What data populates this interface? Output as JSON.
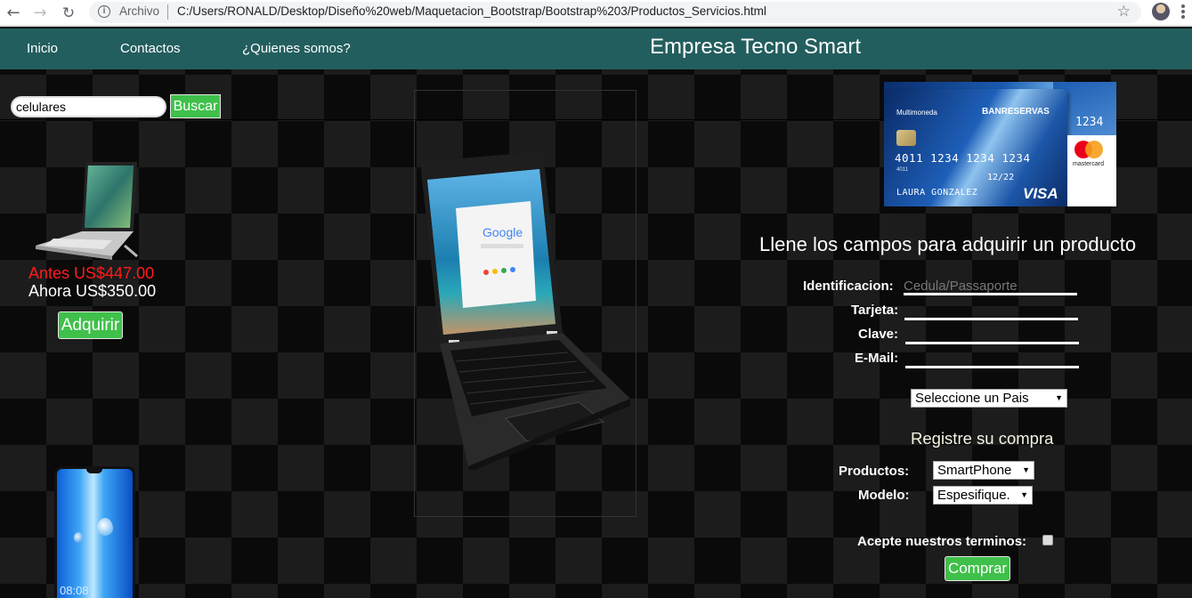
{
  "browser": {
    "scheme_label": "Archivo",
    "url": "C:/Users/RONALD/Desktop/Dise%C3%B1o%20web/Maquetacion_Bootstrap/Bootstrap%203/Productos_Servicios.html",
    "url_display": "C:/Users/RONALD/Desktop/Diseño%20web/Maquetacion_Bootstrap/Bootstrap%203/Productos_Servicios.html"
  },
  "navbar": {
    "links": [
      "Inicio",
      "Contactos",
      "¿Quienes somos?"
    ],
    "brand": "Empresa Tecno Smart",
    "color": "#235e5e"
  },
  "search": {
    "value": "celulares",
    "button_label": "Buscar"
  },
  "product": {
    "price_old": "Antes US$447.00",
    "price_new": "Ahora US$350.00",
    "buy_label": "Adquirir",
    "phone_time": "08:08"
  },
  "card": {
    "bank": "BANRESERVAS",
    "type": "Multimoneda",
    "number": "4011 1234 1234 1234",
    "number_short": "4011",
    "expiry": "12/22",
    "holder": "LAURA GONZALEZ",
    "network": "VISA",
    "mastercard": "mastercard",
    "back_digits": "1234"
  },
  "form": {
    "title": "Llene los campos para adquirir un producto",
    "fields": {
      "id_label": "Identificacion:",
      "id_placeholder": "Cedula/Passaporte",
      "card_label": "Tarjeta:",
      "pass_label": "Clave:",
      "email_label": "E-Mail:"
    },
    "country_select": "Seleccione un Pais",
    "register_title": "Registre su compra",
    "products_label": "Productos:",
    "products_value": "SmartPhone",
    "model_label": "Modelo:",
    "model_value": "Espesifique.",
    "terms_label": "Acepte nuestros terminos:",
    "submit_label": "Comprar"
  },
  "colors": {
    "accent_green": "#3fc04a",
    "old_price": "#ff1b1b"
  }
}
